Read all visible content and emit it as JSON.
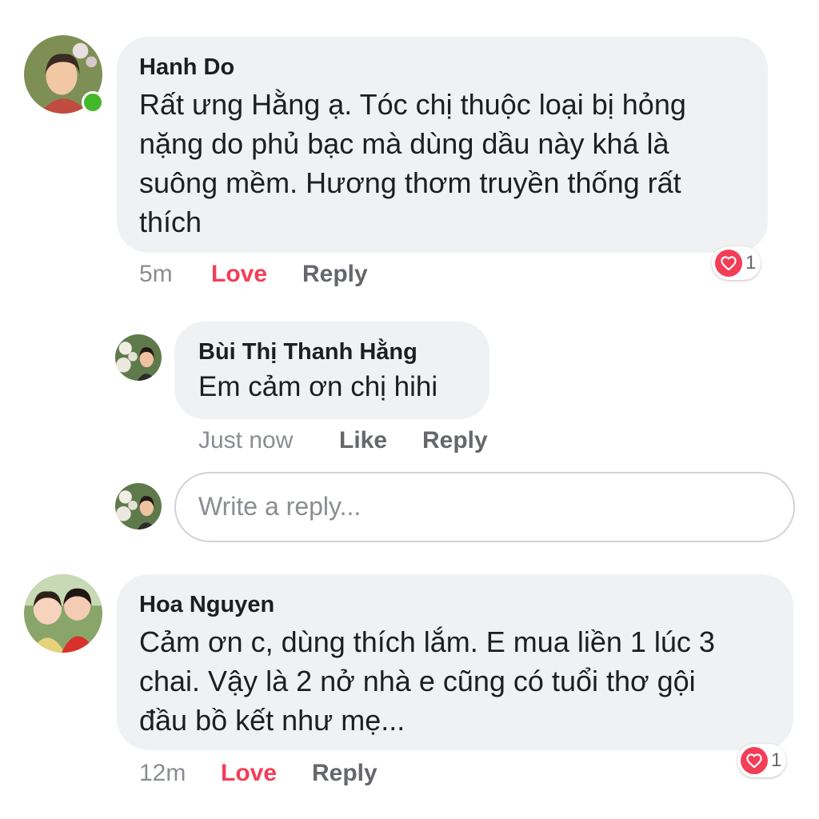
{
  "comments": [
    {
      "author": "Hanh Do",
      "text_lines": [
        "Rất ưng Hằng ạ. Tóc chị thuộc loại bị hỏng",
        "nặng do phủ bạc mà dùng dầu này khá là",
        "suông mềm. Hương thơm truyền thống rất",
        "thích"
      ],
      "time": "5m",
      "reaction_label": "Love",
      "reply_label": "Reply",
      "reaction_count": "1",
      "online": true
    },
    {
      "author": "Bùi Thị Thanh Hằng",
      "text_lines": [
        "Em cảm ơn chị hihi"
      ],
      "time": "Just now",
      "reaction_label": "Like",
      "reply_label": "Reply"
    },
    {
      "author": "Hoa Nguyen",
      "text_lines": [
        "Cảm ơn c, dùng thích lắm. E mua liền 1 lúc 3",
        "chai. Vậy là 2 nở nhà e cũng có tuổi thơ gội",
        "đầu bồ kết như mẹ..."
      ],
      "time": "12m",
      "reaction_label": "Love",
      "reply_label": "Reply",
      "reaction_count": "1"
    }
  ],
  "reply_box": {
    "placeholder": "Write a reply..."
  },
  "colors": {
    "love": "#f33e58",
    "bubble": "#f0f1f3",
    "online": "#42b72a"
  },
  "icons": [
    "heart-icon",
    "online-status-icon"
  ]
}
